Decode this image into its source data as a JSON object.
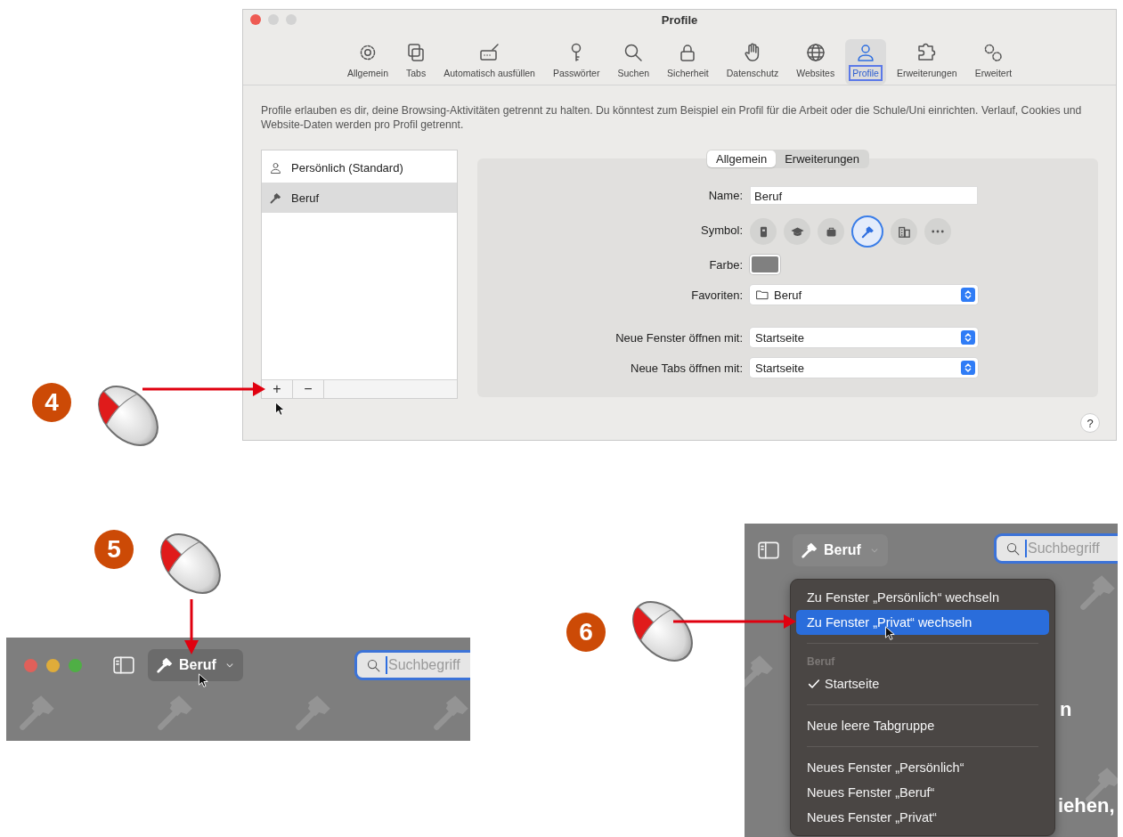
{
  "settings_window": {
    "title": "Profile",
    "toolbar": [
      {
        "kind": "gear",
        "label": "Allgemein",
        "selected": false
      },
      {
        "kind": "tabs",
        "label": "Tabs",
        "selected": false
      },
      {
        "kind": "autofill",
        "label": "Automatisch ausfüllen",
        "selected": false
      },
      {
        "kind": "key",
        "label": "Passwörter",
        "selected": false
      },
      {
        "kind": "search",
        "label": "Suchen",
        "selected": false
      },
      {
        "kind": "lock",
        "label": "Sicherheit",
        "selected": false
      },
      {
        "kind": "hand",
        "label": "Datenschutz",
        "selected": false
      },
      {
        "kind": "globe",
        "label": "Websites",
        "selected": false
      },
      {
        "kind": "person",
        "label": "Profile",
        "selected": true
      },
      {
        "kind": "puzzle",
        "label": "Erweiterungen",
        "selected": false
      },
      {
        "kind": "gears",
        "label": "Erweitert",
        "selected": false
      }
    ],
    "description": "Profile erlauben es dir, deine Browsing-Aktivitäten getrennt zu halten. Du könntest zum Beispiel ein Profil für die Arbeit oder die Schule/Uni einrichten. Verlauf, Cookies und Website-Daten werden pro Profil getrennt.",
    "profiles": [
      {
        "kind": "person",
        "name": "Persönlich (Standard)",
        "selected": false
      },
      {
        "kind": "hammer",
        "name": "Beruf",
        "selected": true
      }
    ],
    "list_buttons": [
      "+",
      "−"
    ],
    "detail_tabs": [
      {
        "label": "Allgemein",
        "selected": true
      },
      {
        "label": "Erweiterungen",
        "selected": false
      }
    ],
    "fields": [
      {
        "kind": "text",
        "label": "Name:",
        "value": "Beruf"
      },
      {
        "kind": "symbols",
        "label": "Symbol:",
        "symbols": [
          {
            "kind": "idcard",
            "selected": false
          },
          {
            "kind": "cap",
            "selected": false
          },
          {
            "kind": "bag",
            "selected": false
          },
          {
            "kind": "hammer",
            "selected": true
          },
          {
            "kind": "building",
            "selected": false
          },
          {
            "kind": "more",
            "selected": false
          }
        ]
      },
      {
        "kind": "color",
        "label": "Farbe:",
        "color": "#808080"
      },
      {
        "kind": "popup",
        "label": "Favoriten:",
        "value": "Beruf",
        "folder": true
      },
      {
        "kind": "popup",
        "label": "Neue Fenster öffnen mit:",
        "value": "Startseite",
        "folder": false
      },
      {
        "kind": "popup",
        "label": "Neue Tabs öffnen mit:",
        "value": "Startseite",
        "folder": false
      }
    ],
    "help": "?"
  },
  "callouts": [
    {
      "number": "4"
    },
    {
      "number": "5"
    },
    {
      "number": "6"
    }
  ],
  "toolbar_window": {
    "profile_button": "Beruf",
    "search_placeholder": "Suchbegriff"
  },
  "menu_window": {
    "profile_button": "Beruf",
    "search_placeholder": "Suchbegriff",
    "background_texts": [
      "n",
      "iehen,"
    ],
    "menu": [
      {
        "kind": "item",
        "label": "Zu Fenster „Persönlich“ wechseln",
        "selected": false,
        "checked": false
      },
      {
        "kind": "item",
        "label": "Zu Fenster „Privat“ wechseln",
        "selected": true,
        "checked": false
      },
      {
        "kind": "separator"
      },
      {
        "kind": "header",
        "label": "Beruf"
      },
      {
        "kind": "item",
        "label": "Startseite",
        "selected": false,
        "checked": true
      },
      {
        "kind": "separator"
      },
      {
        "kind": "item",
        "label": "Neue leere Tabgruppe",
        "selected": false,
        "checked": false
      },
      {
        "kind": "separator"
      },
      {
        "kind": "item",
        "label": "Neues Fenster „Persönlich“",
        "selected": false,
        "checked": false
      },
      {
        "kind": "item",
        "label": "Neues Fenster „Beruf“",
        "selected": false,
        "checked": false
      },
      {
        "kind": "item",
        "label": "Neues Fenster „Privat“",
        "selected": false,
        "checked": false
      }
    ]
  }
}
